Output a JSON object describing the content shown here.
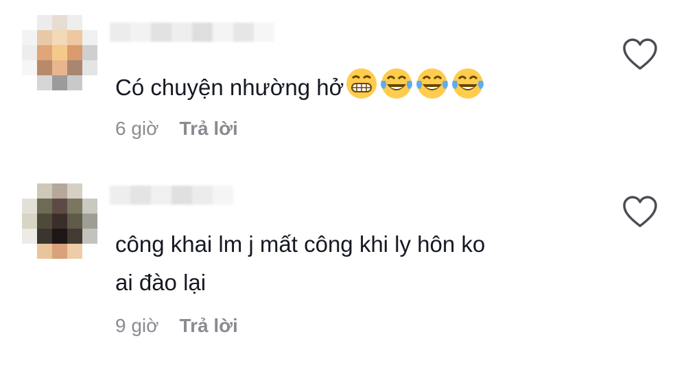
{
  "comments": [
    {
      "text": "Có chuyện nhường hở",
      "emojis": [
        "grinning-face-icon",
        "tears-of-joy-icon",
        "tears-of-joy-icon",
        "tears-of-joy-icon"
      ],
      "time": "6 giờ",
      "reply_label": "Trả lời"
    },
    {
      "text_line1": "công khai lm j mất công khi ly hôn ko",
      "text_line2": "ai đào lại",
      "time": "9 giờ",
      "reply_label": "Trả lời"
    }
  ],
  "colors": {
    "text": "#161823",
    "meta": "#8a8b91",
    "heart": "#4b4b53",
    "emoji_face": "#FFCC4D"
  }
}
